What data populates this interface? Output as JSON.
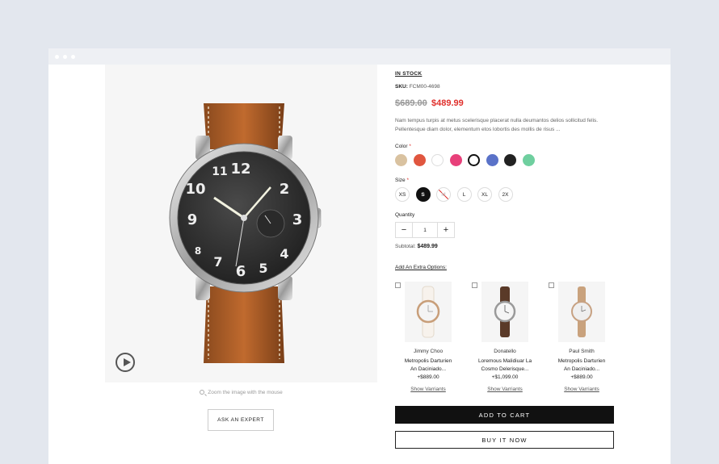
{
  "stock_status": "IN STOCK",
  "sku": {
    "label": "SKU:",
    "value": "FCM00-4698"
  },
  "price": {
    "old": "$689.00",
    "new": "$489.99",
    "accent": "#e0302c"
  },
  "description": "Nam tempus turpis at metus scelerisque placerat nulla deumantos delios sollicitud felis. Pellentesque diam dolor, elementum etos lobortis des mollis de risus ...",
  "color": {
    "label": "Color",
    "required_mark": "*",
    "swatches": [
      "#d9c2a0",
      "#e0563f",
      "#ffffff",
      "#e8407a",
      "#ffffff",
      "#5a72c8",
      "#222222",
      "#6fcf9f"
    ],
    "selected_index": 4
  },
  "size": {
    "label": "Size",
    "required_mark": "*",
    "options": [
      "XS",
      "S",
      "M",
      "L",
      "XL",
      "2X"
    ],
    "selected": "S",
    "unavailable": "M"
  },
  "quantity": {
    "label": "Quantity",
    "value": "1",
    "minus": "−",
    "plus": "+"
  },
  "subtotal": {
    "label": "Subtotal:",
    "value": "$489.99"
  },
  "extra_options": {
    "label": "Add An Extra Options:",
    "items": [
      {
        "brand": "Jimmy Choo",
        "name_line1": "Metropolis Darturien",
        "name_line2": "An Daciniado...",
        "price": "+$889.00",
        "variants": "Show Varriants",
        "watch": "white-strap-watch-icon"
      },
      {
        "brand": "Donatello",
        "name_line1": "Loremous Malidiuar La",
        "name_line2": "Cosmo Delerisque...",
        "price": "+$1,099.00",
        "variants": "Show Varriants",
        "watch": "brown-strap-watch-icon"
      },
      {
        "brand": "Paul Smith",
        "name_line1": "Metropolis Darturien",
        "name_line2": "An Daciniado...",
        "price": "+$889.00",
        "variants": "Show Varriants",
        "watch": "tan-strap-watch-icon"
      }
    ]
  },
  "add_to_cart": "ADD TO CART",
  "buy_it_now": "BUY IT NOW",
  "zoom_hint": "Zoom the image with the mouse",
  "ask_expert": "ASK AN EXPERT",
  "dial_numerals": [
    "12",
    "2",
    "3",
    "4",
    "5",
    "6",
    "7",
    "8",
    "9",
    "10",
    "11"
  ]
}
